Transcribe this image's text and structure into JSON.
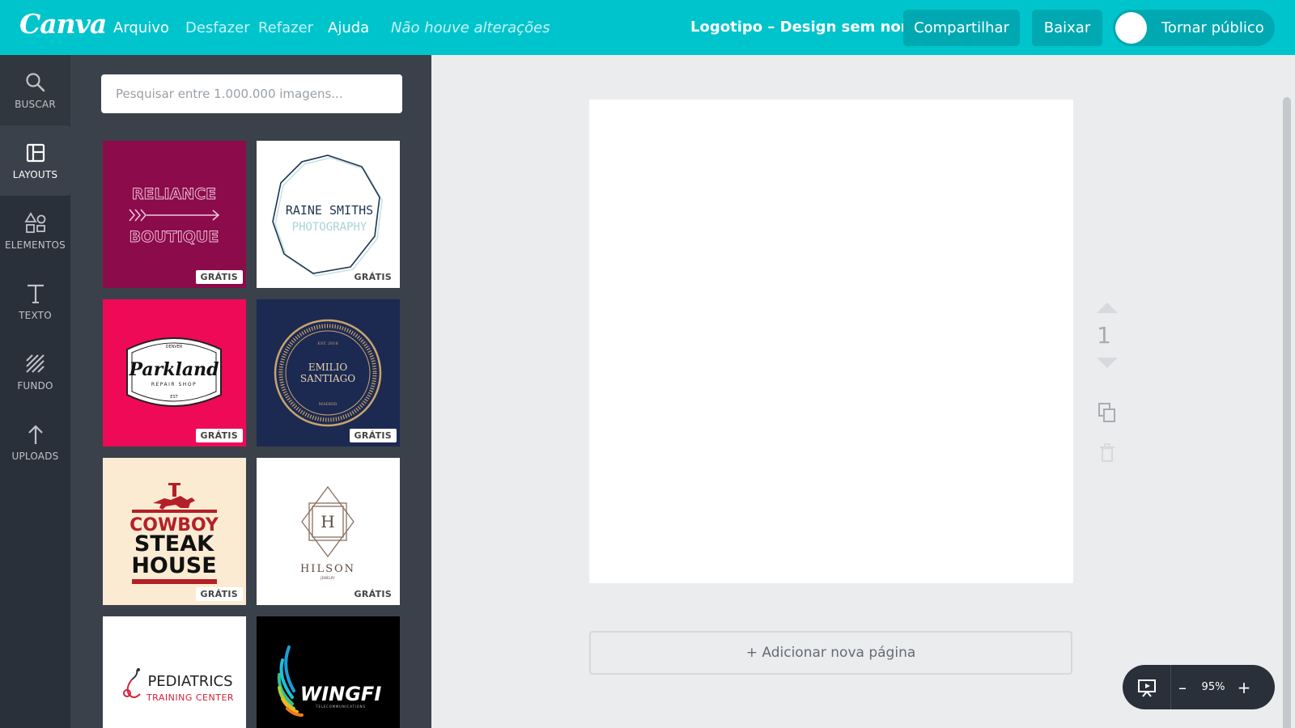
{
  "app": {
    "logo": "Canva"
  },
  "menu": {
    "file": "Arquivo",
    "undo": "Desfazer",
    "redo": "Refazer",
    "help": "Ajuda",
    "status": "Não houve alterações"
  },
  "document": {
    "title": "Logotipo – Design sem nome"
  },
  "actions": {
    "share": "Compartilhar",
    "download": "Baixar",
    "make_public": "Tornar público"
  },
  "nav": {
    "items": [
      {
        "label": "BUSCAR",
        "icon": "search-icon"
      },
      {
        "label": "LAYOUTS",
        "icon": "layout-icon"
      },
      {
        "label": "ELEMENTOS",
        "icon": "shapes-icon"
      },
      {
        "label": "TEXTO",
        "icon": "text-icon"
      },
      {
        "label": "FUNDO",
        "icon": "background-icon"
      },
      {
        "label": "UPLOADS",
        "icon": "upload-icon"
      }
    ]
  },
  "panel": {
    "search_placeholder": "Pesquisar entre 1.000.000 imagens...",
    "badge": "GRÁTIS",
    "templates": [
      {
        "lines": [
          "RELIANCE",
          "BOUTIQUE"
        ],
        "bg": "#8c0b4b"
      },
      {
        "lines": [
          "RAINE SMITHS",
          "PHOTOGRAPHY"
        ],
        "bg": "#ffffff"
      },
      {
        "lines": [
          "DENVER",
          "Parkland",
          "REPAIR SHOP",
          "EST"
        ],
        "bg": "#ee0a56"
      },
      {
        "lines": [
          "EST. 2016",
          "EMILIO",
          "SANTIAGO",
          "MADRID"
        ],
        "bg": "#1c2a52"
      },
      {
        "lines": [
          "COWBOY",
          "STEAK",
          "HOUSE"
        ],
        "bg": "#fbebd2"
      },
      {
        "lines": [
          "H",
          "HILSON",
          "JEWELRY"
        ],
        "bg": "#ffffff"
      },
      {
        "lines": [
          "PEDIATRICS",
          "TRAINING CENTER"
        ],
        "bg": "#ffffff"
      },
      {
        "lines": [
          "WINGFI",
          "TELECOMMUNICATIONS"
        ],
        "bg": "#000000"
      }
    ]
  },
  "canvas": {
    "page_number": "1",
    "add_page": "+ Adicionar nova página",
    "zoom": "95%",
    "zoom_minus": "–",
    "zoom_plus": "+"
  },
  "colors": {
    "brand": "#00c4cc",
    "nav_bg": "#293039",
    "panel_bg": "#3b414a"
  }
}
